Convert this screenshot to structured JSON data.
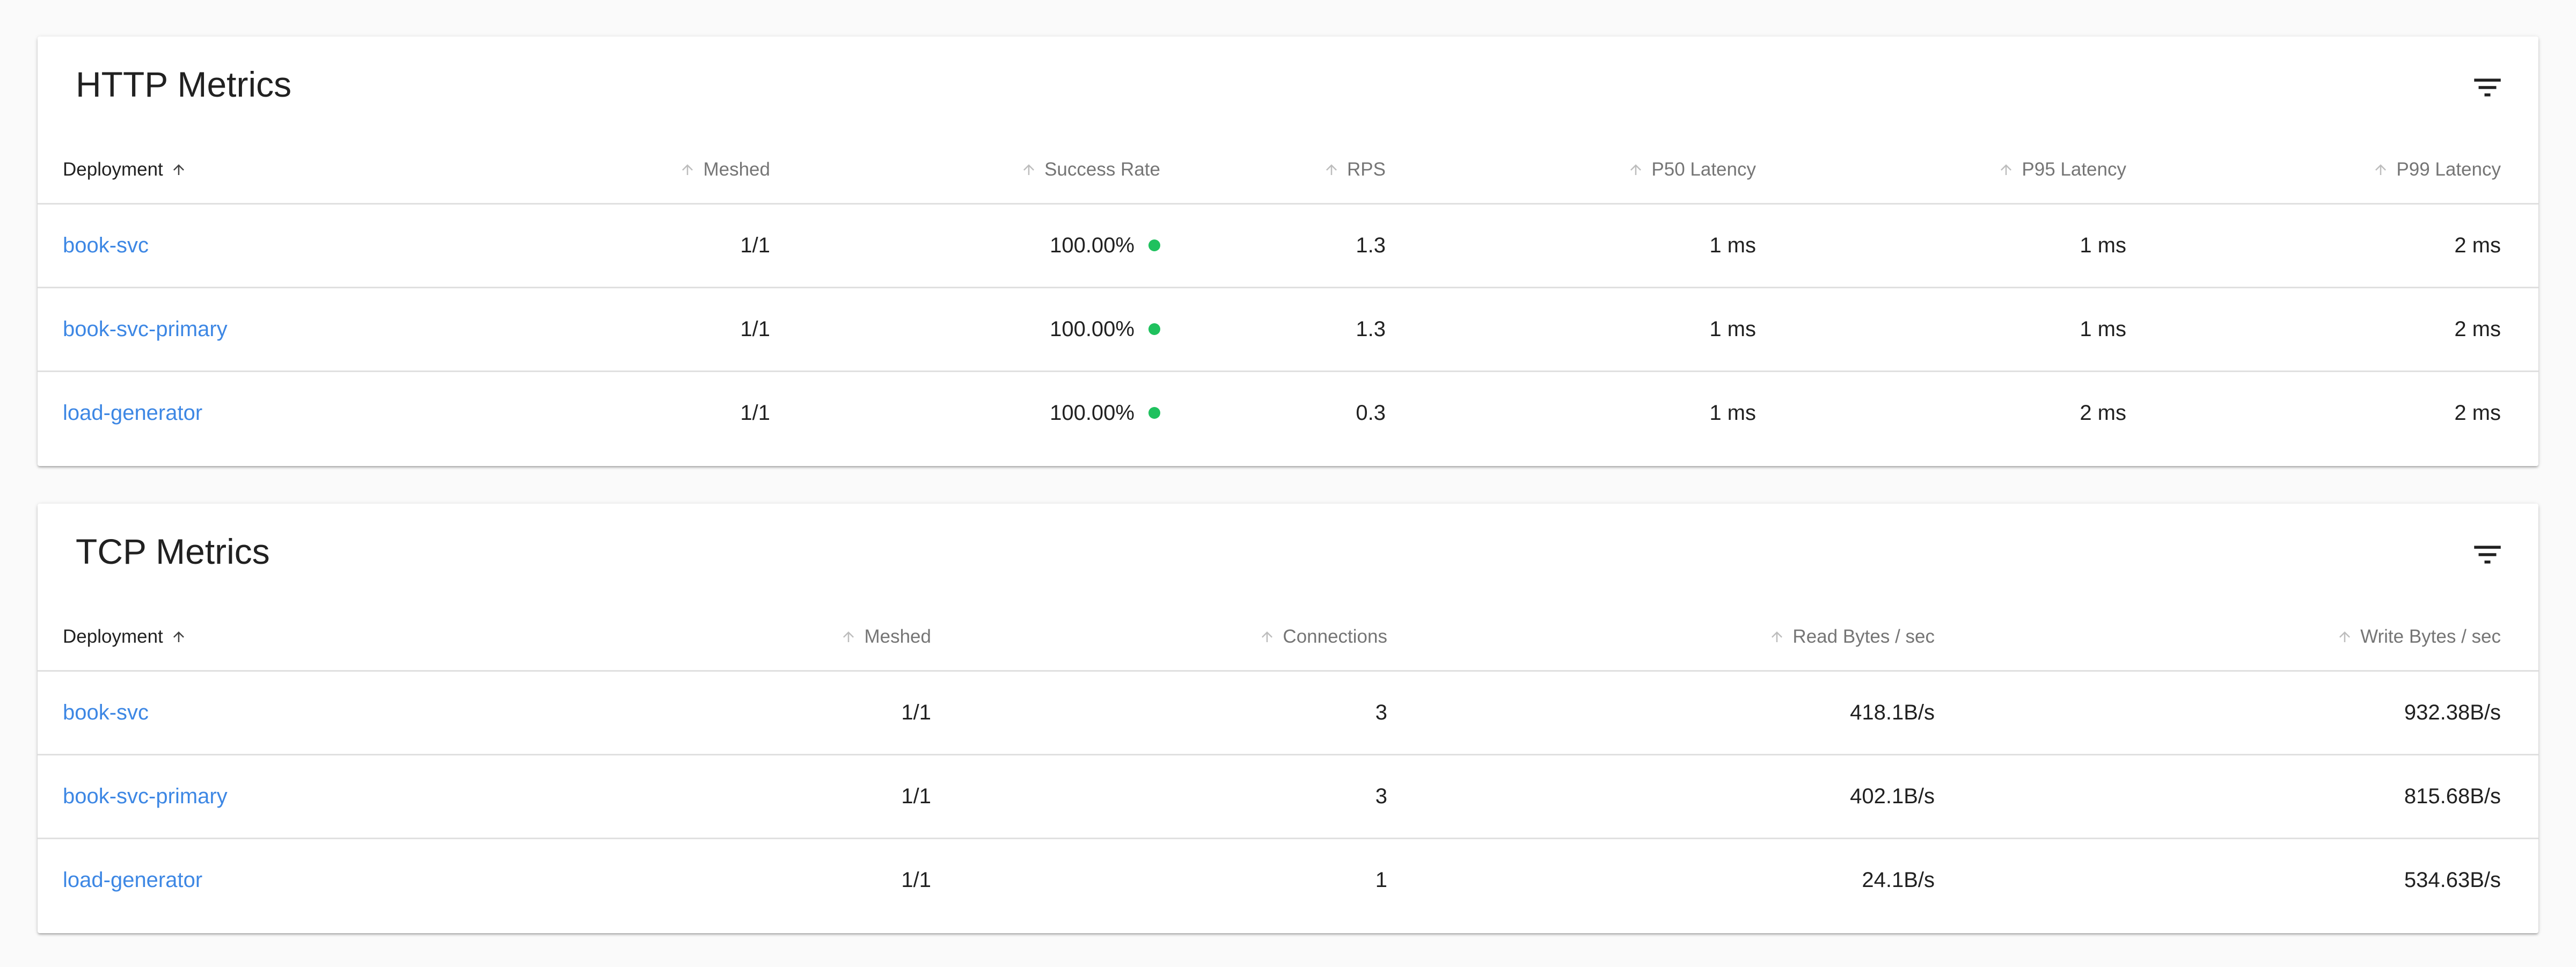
{
  "colors": {
    "link": "#3d87e4",
    "success": "#1fc15e"
  },
  "http": {
    "title": "HTTP Metrics",
    "filter_icon": "filter-list-icon",
    "columns": [
      "Deployment",
      "Meshed",
      "Success Rate",
      "RPS",
      "P50 Latency",
      "P95 Latency",
      "P99 Latency"
    ],
    "rows": [
      {
        "deployment": "book-svc",
        "meshed": "1/1",
        "success_rate": "100.00%",
        "rps": "1.3",
        "p50": "1 ms",
        "p95": "1 ms",
        "p99": "2 ms"
      },
      {
        "deployment": "book-svc-primary",
        "meshed": "1/1",
        "success_rate": "100.00%",
        "rps": "1.3",
        "p50": "1 ms",
        "p95": "1 ms",
        "p99": "2 ms"
      },
      {
        "deployment": "load-generator",
        "meshed": "1/1",
        "success_rate": "100.00%",
        "rps": "0.3",
        "p50": "1 ms",
        "p95": "2 ms",
        "p99": "2 ms"
      }
    ]
  },
  "tcp": {
    "title": "TCP Metrics",
    "filter_icon": "filter-list-icon",
    "columns": [
      "Deployment",
      "Meshed",
      "Connections",
      "Read Bytes / sec",
      "Write Bytes / sec"
    ],
    "rows": [
      {
        "deployment": "book-svc",
        "meshed": "1/1",
        "connections": "3",
        "read": "418.1B/s",
        "write": "932.38B/s"
      },
      {
        "deployment": "book-svc-primary",
        "meshed": "1/1",
        "connections": "3",
        "read": "402.1B/s",
        "write": "815.68B/s"
      },
      {
        "deployment": "load-generator",
        "meshed": "1/1",
        "connections": "1",
        "read": "24.1B/s",
        "write": "534.63B/s"
      }
    ]
  }
}
